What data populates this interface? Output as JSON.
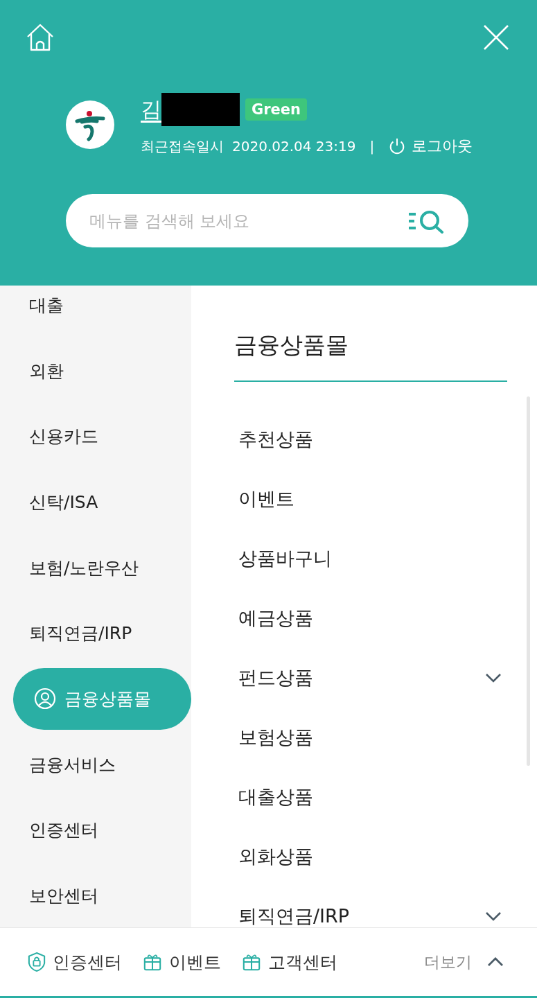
{
  "header": {
    "user_name": "김",
    "grade_badge": "Green",
    "last_login_label": "최근접속일시",
    "last_login_time": "2020.02.04 23:19",
    "separator": "|",
    "logout": "로그아웃",
    "search": {
      "placeholder": "메뉴를 검색해 보세요"
    }
  },
  "sidebar": {
    "items": [
      {
        "label": "대출",
        "selected": false
      },
      {
        "label": "외환",
        "selected": false
      },
      {
        "label": "신용카드",
        "selected": false
      },
      {
        "label": "신탁/ISA",
        "selected": false
      },
      {
        "label": "보험/노란우산",
        "selected": false
      },
      {
        "label": "퇴직연금/IRP",
        "selected": false
      },
      {
        "label": "금융상품몰",
        "selected": true
      },
      {
        "label": "금융서비스",
        "selected": false
      },
      {
        "label": "인증센터",
        "selected": false
      },
      {
        "label": "보안센터",
        "selected": false
      }
    ]
  },
  "panel": {
    "title": "금융상품몰",
    "items": [
      {
        "label": "추천상품",
        "expandable": false
      },
      {
        "label": "이벤트",
        "expandable": false
      },
      {
        "label": "상품바구니",
        "expandable": false
      },
      {
        "label": "예금상품",
        "expandable": false
      },
      {
        "label": "펀드상품",
        "expandable": true
      },
      {
        "label": "보험상품",
        "expandable": false
      },
      {
        "label": "대출상품",
        "expandable": false
      },
      {
        "label": "외화상품",
        "expandable": false
      },
      {
        "label": "퇴직연금/IRP",
        "expandable": true
      }
    ]
  },
  "bottom_bar": {
    "links": [
      {
        "label": "인증센터",
        "kind": "shield"
      },
      {
        "label": "이벤트",
        "kind": "gift"
      },
      {
        "label": "고객센터",
        "kind": "gift"
      }
    ],
    "more": "더보기"
  }
}
